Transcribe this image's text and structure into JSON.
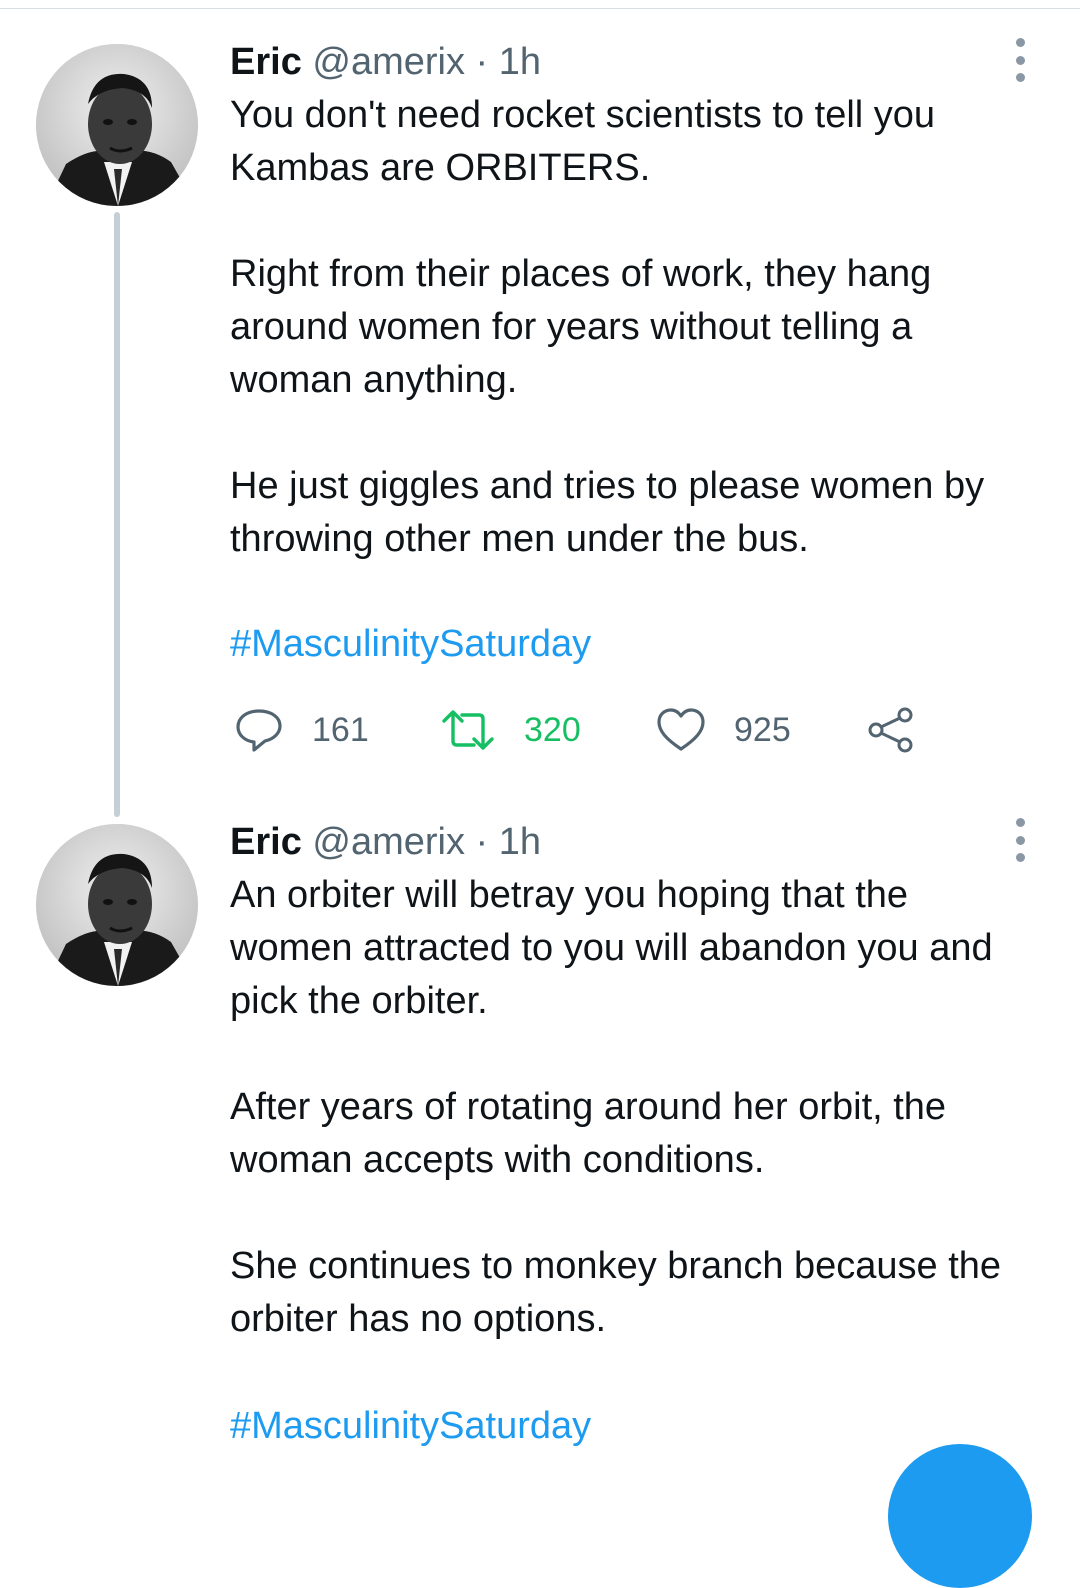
{
  "colors": {
    "link": "#1d9bf0",
    "retweet_active": "#17bf63",
    "muted": "#536471",
    "thread_line": "#c4cfd6"
  },
  "tweets": [
    {
      "author": {
        "name": "Eric",
        "handle": "@amerix"
      },
      "separator": "·",
      "time": "1h",
      "paragraphs": [
        [
          "You don't need rocket scientists to tell you",
          "Kambas are ORBITERS."
        ],
        [
          "Right from their places of work, they hang",
          "around women for years without telling a",
          "woman anything."
        ],
        [
          "He just giggles and tries to please women by",
          "throwing other men under the bus."
        ]
      ],
      "hashtag": "#MasculinitySaturday",
      "actions": {
        "replies": {
          "icon": "reply-icon",
          "count": "161"
        },
        "retweets": {
          "icon": "retweet-icon",
          "count": "320"
        },
        "likes": {
          "icon": "heart-icon",
          "count": "925"
        },
        "share": {
          "icon": "share-icon"
        }
      }
    },
    {
      "author": {
        "name": "Eric",
        "handle": "@amerix"
      },
      "separator": "·",
      "time": "1h",
      "paragraphs": [
        [
          "An orbiter will betray you hoping that the",
          "women attracted to you will abandon you and",
          "pick the orbiter."
        ],
        [
          "After years of rotating around her orbit, the",
          "woman accepts with conditions."
        ],
        [
          "She continues to monkey branch because the",
          "orbiter has no options."
        ]
      ],
      "hashtag": "#MasculinitySaturday"
    }
  ],
  "compose_button": {
    "icon": "compose-icon"
  }
}
